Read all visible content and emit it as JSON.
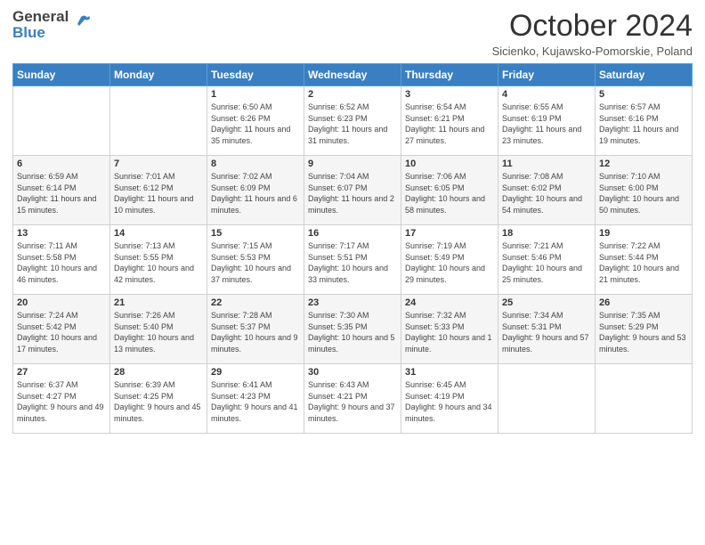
{
  "header": {
    "logo_general": "General",
    "logo_blue": "Blue",
    "month_title": "October 2024",
    "location": "Sicienko, Kujawsko-Pomorskie, Poland"
  },
  "columns": [
    "Sunday",
    "Monday",
    "Tuesday",
    "Wednesday",
    "Thursday",
    "Friday",
    "Saturday"
  ],
  "weeks": [
    [
      {
        "day": "",
        "info": ""
      },
      {
        "day": "",
        "info": ""
      },
      {
        "day": "1",
        "info": "Sunrise: 6:50 AM\nSunset: 6:26 PM\nDaylight: 11 hours and 35 minutes."
      },
      {
        "day": "2",
        "info": "Sunrise: 6:52 AM\nSunset: 6:23 PM\nDaylight: 11 hours and 31 minutes."
      },
      {
        "day": "3",
        "info": "Sunrise: 6:54 AM\nSunset: 6:21 PM\nDaylight: 11 hours and 27 minutes."
      },
      {
        "day": "4",
        "info": "Sunrise: 6:55 AM\nSunset: 6:19 PM\nDaylight: 11 hours and 23 minutes."
      },
      {
        "day": "5",
        "info": "Sunrise: 6:57 AM\nSunset: 6:16 PM\nDaylight: 11 hours and 19 minutes."
      }
    ],
    [
      {
        "day": "6",
        "info": "Sunrise: 6:59 AM\nSunset: 6:14 PM\nDaylight: 11 hours and 15 minutes."
      },
      {
        "day": "7",
        "info": "Sunrise: 7:01 AM\nSunset: 6:12 PM\nDaylight: 11 hours and 10 minutes."
      },
      {
        "day": "8",
        "info": "Sunrise: 7:02 AM\nSunset: 6:09 PM\nDaylight: 11 hours and 6 minutes."
      },
      {
        "day": "9",
        "info": "Sunrise: 7:04 AM\nSunset: 6:07 PM\nDaylight: 11 hours and 2 minutes."
      },
      {
        "day": "10",
        "info": "Sunrise: 7:06 AM\nSunset: 6:05 PM\nDaylight: 10 hours and 58 minutes."
      },
      {
        "day": "11",
        "info": "Sunrise: 7:08 AM\nSunset: 6:02 PM\nDaylight: 10 hours and 54 minutes."
      },
      {
        "day": "12",
        "info": "Sunrise: 7:10 AM\nSunset: 6:00 PM\nDaylight: 10 hours and 50 minutes."
      }
    ],
    [
      {
        "day": "13",
        "info": "Sunrise: 7:11 AM\nSunset: 5:58 PM\nDaylight: 10 hours and 46 minutes."
      },
      {
        "day": "14",
        "info": "Sunrise: 7:13 AM\nSunset: 5:55 PM\nDaylight: 10 hours and 42 minutes."
      },
      {
        "day": "15",
        "info": "Sunrise: 7:15 AM\nSunset: 5:53 PM\nDaylight: 10 hours and 37 minutes."
      },
      {
        "day": "16",
        "info": "Sunrise: 7:17 AM\nSunset: 5:51 PM\nDaylight: 10 hours and 33 minutes."
      },
      {
        "day": "17",
        "info": "Sunrise: 7:19 AM\nSunset: 5:49 PM\nDaylight: 10 hours and 29 minutes."
      },
      {
        "day": "18",
        "info": "Sunrise: 7:21 AM\nSunset: 5:46 PM\nDaylight: 10 hours and 25 minutes."
      },
      {
        "day": "19",
        "info": "Sunrise: 7:22 AM\nSunset: 5:44 PM\nDaylight: 10 hours and 21 minutes."
      }
    ],
    [
      {
        "day": "20",
        "info": "Sunrise: 7:24 AM\nSunset: 5:42 PM\nDaylight: 10 hours and 17 minutes."
      },
      {
        "day": "21",
        "info": "Sunrise: 7:26 AM\nSunset: 5:40 PM\nDaylight: 10 hours and 13 minutes."
      },
      {
        "day": "22",
        "info": "Sunrise: 7:28 AM\nSunset: 5:37 PM\nDaylight: 10 hours and 9 minutes."
      },
      {
        "day": "23",
        "info": "Sunrise: 7:30 AM\nSunset: 5:35 PM\nDaylight: 10 hours and 5 minutes."
      },
      {
        "day": "24",
        "info": "Sunrise: 7:32 AM\nSunset: 5:33 PM\nDaylight: 10 hours and 1 minute."
      },
      {
        "day": "25",
        "info": "Sunrise: 7:34 AM\nSunset: 5:31 PM\nDaylight: 9 hours and 57 minutes."
      },
      {
        "day": "26",
        "info": "Sunrise: 7:35 AM\nSunset: 5:29 PM\nDaylight: 9 hours and 53 minutes."
      }
    ],
    [
      {
        "day": "27",
        "info": "Sunrise: 6:37 AM\nSunset: 4:27 PM\nDaylight: 9 hours and 49 minutes."
      },
      {
        "day": "28",
        "info": "Sunrise: 6:39 AM\nSunset: 4:25 PM\nDaylight: 9 hours and 45 minutes."
      },
      {
        "day": "29",
        "info": "Sunrise: 6:41 AM\nSunset: 4:23 PM\nDaylight: 9 hours and 41 minutes."
      },
      {
        "day": "30",
        "info": "Sunrise: 6:43 AM\nSunset: 4:21 PM\nDaylight: 9 hours and 37 minutes."
      },
      {
        "day": "31",
        "info": "Sunrise: 6:45 AM\nSunset: 4:19 PM\nDaylight: 9 hours and 34 minutes."
      },
      {
        "day": "",
        "info": ""
      },
      {
        "day": "",
        "info": ""
      }
    ]
  ]
}
